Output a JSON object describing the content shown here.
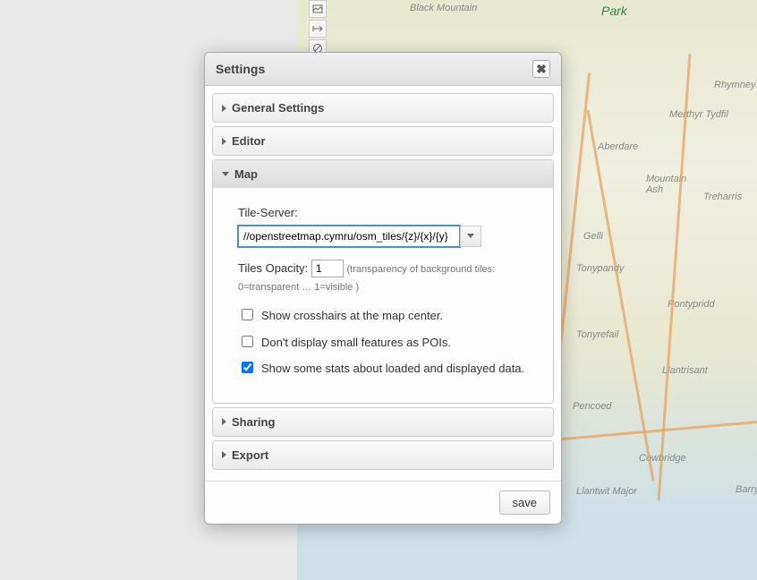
{
  "map": {
    "labels": {
      "blackMountain": "Black Mountain",
      "park": "Park",
      "rhymney": "Rhymney",
      "merthyrTydfil": "Merthyr Tydfil",
      "aberdare": "Aberdare",
      "mountainAsh": "Mountain\nAsh",
      "treharris": "Treharris",
      "gelli": "Gelli",
      "tonypandy": "Tonypandy",
      "pontypridd": "Pontypridd",
      "tonyrefail": "Tonyrefail",
      "llantrisant": "Llantrisant",
      "pencoed": "Pencoed",
      "cowbridge": "Cowbridge",
      "llantwitMajor": "Llantwit Major",
      "barry": "Barry"
    }
  },
  "toolbar": {
    "icon1": "image-icon",
    "icon2": "width-icon",
    "icon3": "cancel-icon"
  },
  "dialog": {
    "title": "Settings",
    "sections": {
      "general": "General Settings",
      "editor": "Editor",
      "map": "Map",
      "sharing": "Sharing",
      "export": "Export"
    },
    "mapSection": {
      "tileServerLabel": "Tile-Server:",
      "tileServerValue": "//openstreetmap.cymru/osm_tiles/{z}/{x}/{y}",
      "tilesOpacityLabel": "Tiles Opacity:",
      "tilesOpacityValue": "1",
      "tilesOpacityHint": "(transparency of background tiles: 0=transparent … 1=visible )",
      "crosshairsLabel": "Show crosshairs at the map center.",
      "smallFeaturesLabel": "Don't display small features as POIs.",
      "statsLabel": "Show some stats about loaded and displayed data.",
      "crosshairsChecked": false,
      "smallFeaturesChecked": false,
      "statsChecked": true
    },
    "saveLabel": "save"
  }
}
